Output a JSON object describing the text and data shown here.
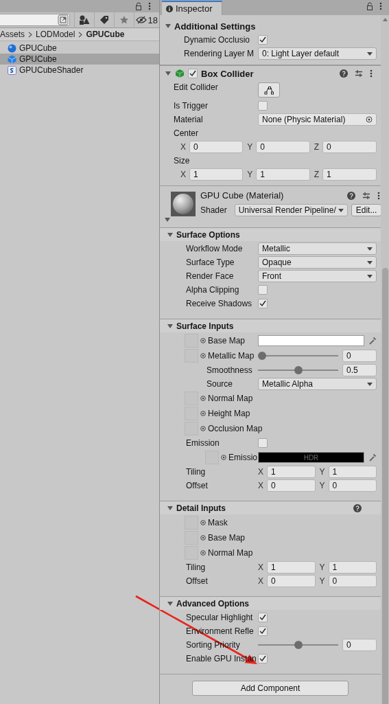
{
  "project": {
    "hidden_count": "18",
    "breadcrumb": [
      {
        "label": "Assets",
        "current": false
      },
      {
        "label": "LODModel",
        "current": false
      },
      {
        "label": "GPUCube",
        "current": true
      }
    ],
    "assets": [
      {
        "name": "GPUCube",
        "kind": "material",
        "selected": false
      },
      {
        "name": "GPUCube",
        "kind": "prefab",
        "selected": true
      },
      {
        "name": "GPUCubeShader",
        "kind": "shader",
        "selected": false
      }
    ]
  },
  "inspector": {
    "tab": "Inspector",
    "sections": [
      {
        "kind": "foldout",
        "title": "Additional Settings",
        "expanded": true,
        "rows": [
          {
            "kind": "check",
            "label": "Dynamic Occlusio",
            "checked": true
          },
          {
            "kind": "dropdown",
            "label": "Rendering Layer M",
            "value": "0: Light Layer default"
          }
        ]
      },
      {
        "kind": "component",
        "title": "Box Collider",
        "enabled": true,
        "expanded": true,
        "rows": [
          {
            "kind": "edit",
            "label": "Edit Collider"
          },
          {
            "kind": "check",
            "label": "Is Trigger",
            "checked": false
          },
          {
            "kind": "object",
            "label": "Material",
            "value": "None (Physic Material)"
          },
          {
            "kind": "vector",
            "label": "Center",
            "fields": [
              {
                "axis": "X",
                "value": "0"
              },
              {
                "axis": "Y",
                "value": "0"
              },
              {
                "axis": "Z",
                "value": "0"
              }
            ]
          },
          {
            "kind": "vector",
            "label": "Size",
            "fields": [
              {
                "axis": "X",
                "value": "1"
              },
              {
                "axis": "Y",
                "value": "1"
              },
              {
                "axis": "Z",
                "value": "1"
              }
            ]
          }
        ]
      },
      {
        "kind": "material",
        "title": "GPU Cube (Material)",
        "expanded": true,
        "shader_label": "Shader",
        "shader": "Universal Render Pipeline/",
        "edit": "Edit..."
      },
      {
        "kind": "group",
        "title": "Surface Options",
        "expanded": true,
        "help": false,
        "rows": [
          {
            "kind": "dropdown",
            "label": "Workflow Mode",
            "value": "Metallic"
          },
          {
            "kind": "dropdown",
            "label": "Surface Type",
            "value": "Opaque"
          },
          {
            "kind": "dropdown",
            "label": "Render Face",
            "value": "Front"
          },
          {
            "kind": "check",
            "label": "Alpha Clipping",
            "checked": false
          },
          {
            "kind": "check",
            "label": "Receive Shadows",
            "checked": true
          }
        ]
      },
      {
        "kind": "group",
        "title": "Surface Inputs",
        "expanded": true,
        "help": false,
        "rows": [
          {
            "kind": "texture",
            "label": "Base Map",
            "color": "#ffffff"
          },
          {
            "kind": "texture",
            "label": "Metallic Map",
            "level": 0,
            "value": "0",
            "children": [
              {
                "kind": "slider",
                "label": "Smoothness",
                "level": 0.5,
                "value": "0.5"
              },
              {
                "kind": "dropdown",
                "label": "Source",
                "value": "Metallic Alpha"
              }
            ]
          },
          {
            "kind": "texture",
            "label": "Normal Map"
          },
          {
            "kind": "texture",
            "label": "Height Map"
          },
          {
            "kind": "texture",
            "label": "Occlusion Map"
          },
          {
            "kind": "check",
            "label": "Emission",
            "checked": false,
            "children": [
              {
                "kind": "texture",
                "label": "Emissio",
                "color": "#000000",
                "badge": "HDR"
              }
            ]
          },
          {
            "kind": "vector-inline",
            "label": "Tiling",
            "fields": [
              {
                "axis": "X",
                "value": "1"
              },
              {
                "axis": "Y",
                "value": "1"
              }
            ]
          },
          {
            "kind": "vector-inline",
            "label": "Offset",
            "fields": [
              {
                "axis": "X",
                "value": "0"
              },
              {
                "axis": "Y",
                "value": "0"
              }
            ]
          }
        ]
      },
      {
        "kind": "group",
        "title": "Detail Inputs",
        "expanded": true,
        "help": true,
        "rows": [
          {
            "kind": "texture",
            "label": "Mask"
          },
          {
            "kind": "texture",
            "label": "Base Map"
          },
          {
            "kind": "texture",
            "label": "Normal Map"
          },
          {
            "kind": "vector-inline",
            "label": "Tiling",
            "fields": [
              {
                "axis": "X",
                "value": "1"
              },
              {
                "axis": "Y",
                "value": "1"
              }
            ]
          },
          {
            "kind": "vector-inline",
            "label": "Offset",
            "fields": [
              {
                "axis": "X",
                "value": "0"
              },
              {
                "axis": "Y",
                "value": "0"
              }
            ]
          }
        ]
      },
      {
        "kind": "group",
        "title": "Advanced Options",
        "expanded": true,
        "help": false,
        "rows": [
          {
            "kind": "check",
            "label": "Specular Highlight",
            "checked": true
          },
          {
            "kind": "check",
            "label": "Environment Refle",
            "checked": true
          },
          {
            "kind": "slider",
            "label": "Sorting Priority",
            "level": 0.5,
            "value": "0"
          },
          {
            "kind": "check",
            "label": "Enable GPU Instan",
            "checked": true
          }
        ]
      }
    ],
    "add_component": "Add Component"
  }
}
